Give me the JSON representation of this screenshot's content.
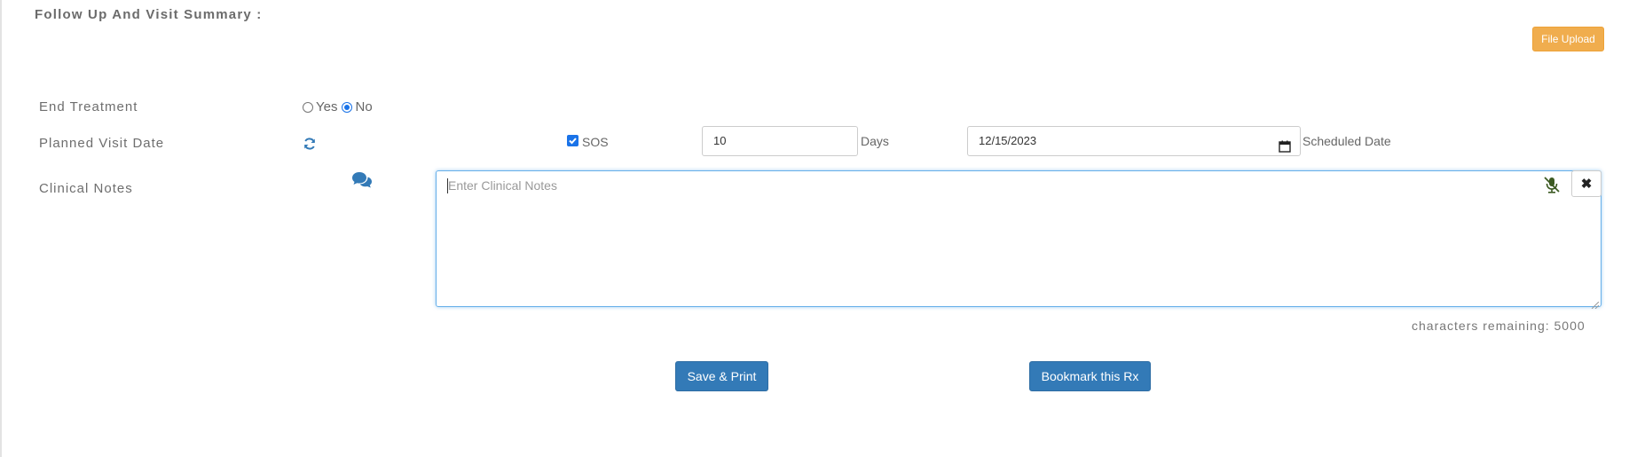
{
  "section": {
    "title": "Follow Up And Visit Summary :"
  },
  "toolbar": {
    "file_upload_label": "File Upload"
  },
  "end_treatment": {
    "label": "End Treatment",
    "options": [
      {
        "label": "Yes",
        "checked": false
      },
      {
        "label": "No",
        "checked": true
      }
    ]
  },
  "planned_visit": {
    "label": "Planned Visit Date",
    "refresh_icon": "refresh-icon",
    "sos_label": "SOS",
    "sos_checked": true,
    "days_value": "10",
    "days_label": "Days",
    "date_value": "12/15/2023",
    "calendar_icon": "calendar-icon",
    "scheduled_label": "Scheduled Date"
  },
  "clinical_notes": {
    "label": "Clinical Notes",
    "chat_icon": "comments-icon",
    "placeholder": "Enter Clinical Notes",
    "value": "",
    "mic_icon": "microphone-slash-icon",
    "close_icon": "close-icon",
    "chars_remaining": "characters remaining: 5000"
  },
  "actions": {
    "save_print_label": "Save & Print",
    "bookmark_label": "Bookmark this Rx"
  },
  "colors": {
    "primary": "#337ab7",
    "warning": "#f0ad4e",
    "accent_blue": "#1a73e8",
    "focus_border": "#66afe9"
  }
}
